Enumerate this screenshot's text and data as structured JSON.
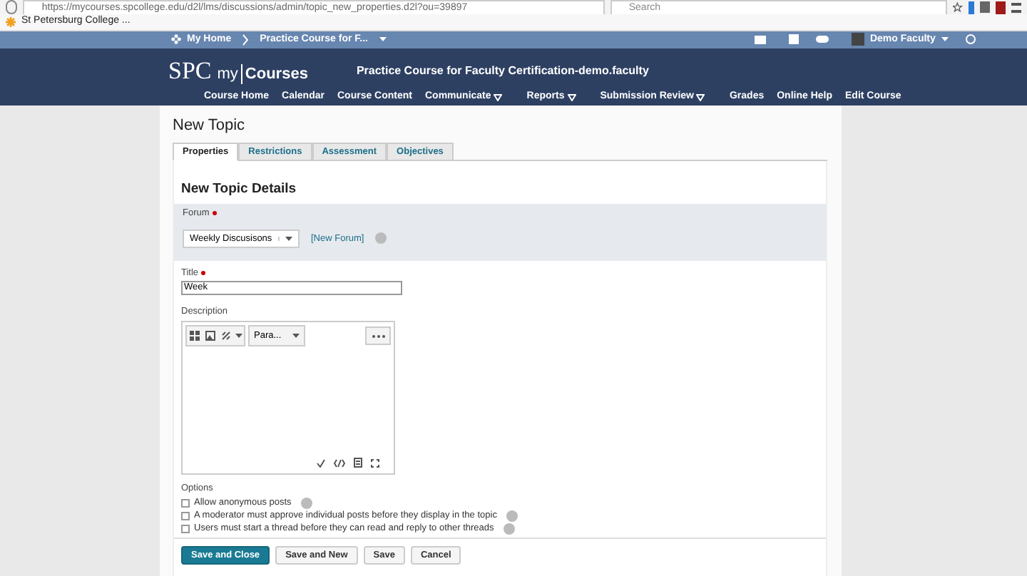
{
  "browser": {
    "url": "https://mycourses.spcollege.edu/d2l/lms/discussions/admin/topic_new_properties.d2l?ou=39897",
    "search_placeholder": "Search",
    "bookmark": "St Petersburg College ..."
  },
  "minibar": {
    "home": "My Home",
    "course": "Practice Course for F...",
    "user": "Demo Faculty"
  },
  "header": {
    "logo_left": "SPC",
    "logo_my": "my",
    "logo_courses": "Courses",
    "course_title": "Practice Course for Faculty Certification-demo.faculty",
    "nav": [
      {
        "label": "Course Home",
        "has_menu": false
      },
      {
        "label": "Calendar",
        "has_menu": false
      },
      {
        "label": "Course Content",
        "has_menu": false
      },
      {
        "label": "Communicate",
        "has_menu": true
      },
      {
        "label": "Reports",
        "has_menu": true
      },
      {
        "label": "Submission Review",
        "has_menu": true
      },
      {
        "label": "Grades",
        "has_menu": false
      },
      {
        "label": "Online Help",
        "has_menu": false
      },
      {
        "label": "Edit Course",
        "has_menu": false
      }
    ]
  },
  "page_title": "New Topic",
  "tabs": [
    {
      "label": "Properties",
      "selected": true
    },
    {
      "label": "Restrictions",
      "selected": false
    },
    {
      "label": "Assessment",
      "selected": false
    },
    {
      "label": "Objectives",
      "selected": false
    }
  ],
  "section_title": "New Topic Details",
  "forum": {
    "label": "Forum",
    "required": true,
    "value": "Weekly Discusisons",
    "link": "[New Forum]"
  },
  "title_field": {
    "label": "Title",
    "required": true,
    "value": "Week"
  },
  "description": {
    "label": "Description",
    "format": "Para..."
  },
  "options": {
    "label": "Options",
    "items": [
      {
        "label": "Allow anonymous posts",
        "checked": false
      },
      {
        "label": "A moderator must approve individual posts before they display in the topic",
        "checked": false
      },
      {
        "label": "Users must start a thread before they can read and reply to other threads",
        "checked": false
      }
    ]
  },
  "buttons": [
    {
      "label": "Save and Close",
      "primary": true
    },
    {
      "label": "Save and New",
      "primary": false
    },
    {
      "label": "Save",
      "primary": false
    },
    {
      "label": "Cancel",
      "primary": false
    }
  ]
}
